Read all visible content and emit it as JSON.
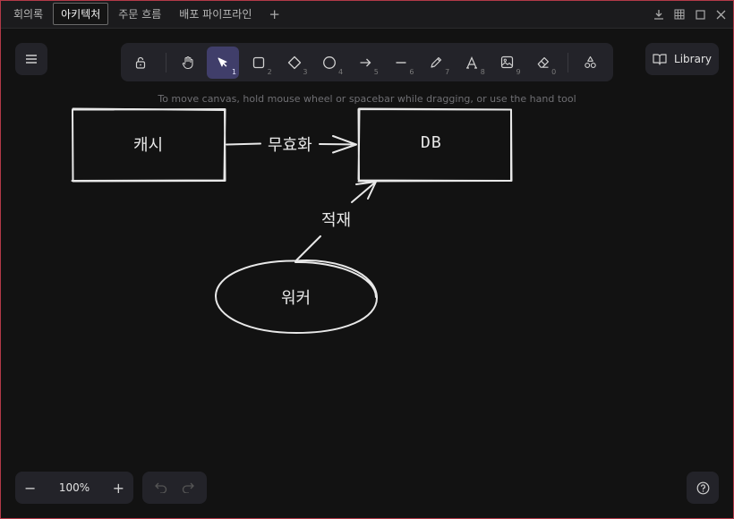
{
  "tabs": [
    {
      "label": "회의록",
      "active": false
    },
    {
      "label": "아키텍처",
      "active": true
    },
    {
      "label": "주문 흐름",
      "active": false
    },
    {
      "label": "배포 파이프라인",
      "active": false
    }
  ],
  "tab_add_label": "+",
  "toolbar": {
    "tools": [
      {
        "icon": "lock-open-icon",
        "key": ""
      },
      {
        "icon": "hand-icon",
        "key": ""
      },
      {
        "icon": "cursor-icon",
        "key": "1",
        "selected": true
      },
      {
        "icon": "rectangle-icon",
        "key": "2"
      },
      {
        "icon": "diamond-icon",
        "key": "3"
      },
      {
        "icon": "ellipse-icon",
        "key": "4"
      },
      {
        "icon": "arrow-icon",
        "key": "5"
      },
      {
        "icon": "line-icon",
        "key": "6"
      },
      {
        "icon": "pencil-icon",
        "key": "7"
      },
      {
        "icon": "text-icon",
        "key": "8"
      },
      {
        "icon": "image-icon",
        "key": "9"
      },
      {
        "icon": "eraser-icon",
        "key": "0"
      },
      {
        "icon": "shapes-icon",
        "key": ""
      }
    ]
  },
  "library_label": "Library",
  "hint": "To move canvas, hold mouse wheel or spacebar while dragging, or use the hand tool",
  "zoom": {
    "minus": "−",
    "value": "100%",
    "plus": "+"
  },
  "diagram": {
    "cache_label": "캐시",
    "db_label": "DB",
    "invalidate_label": "무효화",
    "load_label": "적재",
    "worker_label": "워커"
  },
  "colors": {
    "accent": "#403e6a",
    "stroke": "#e8e8e8",
    "canvas": "#121212",
    "panel": "#232329"
  }
}
